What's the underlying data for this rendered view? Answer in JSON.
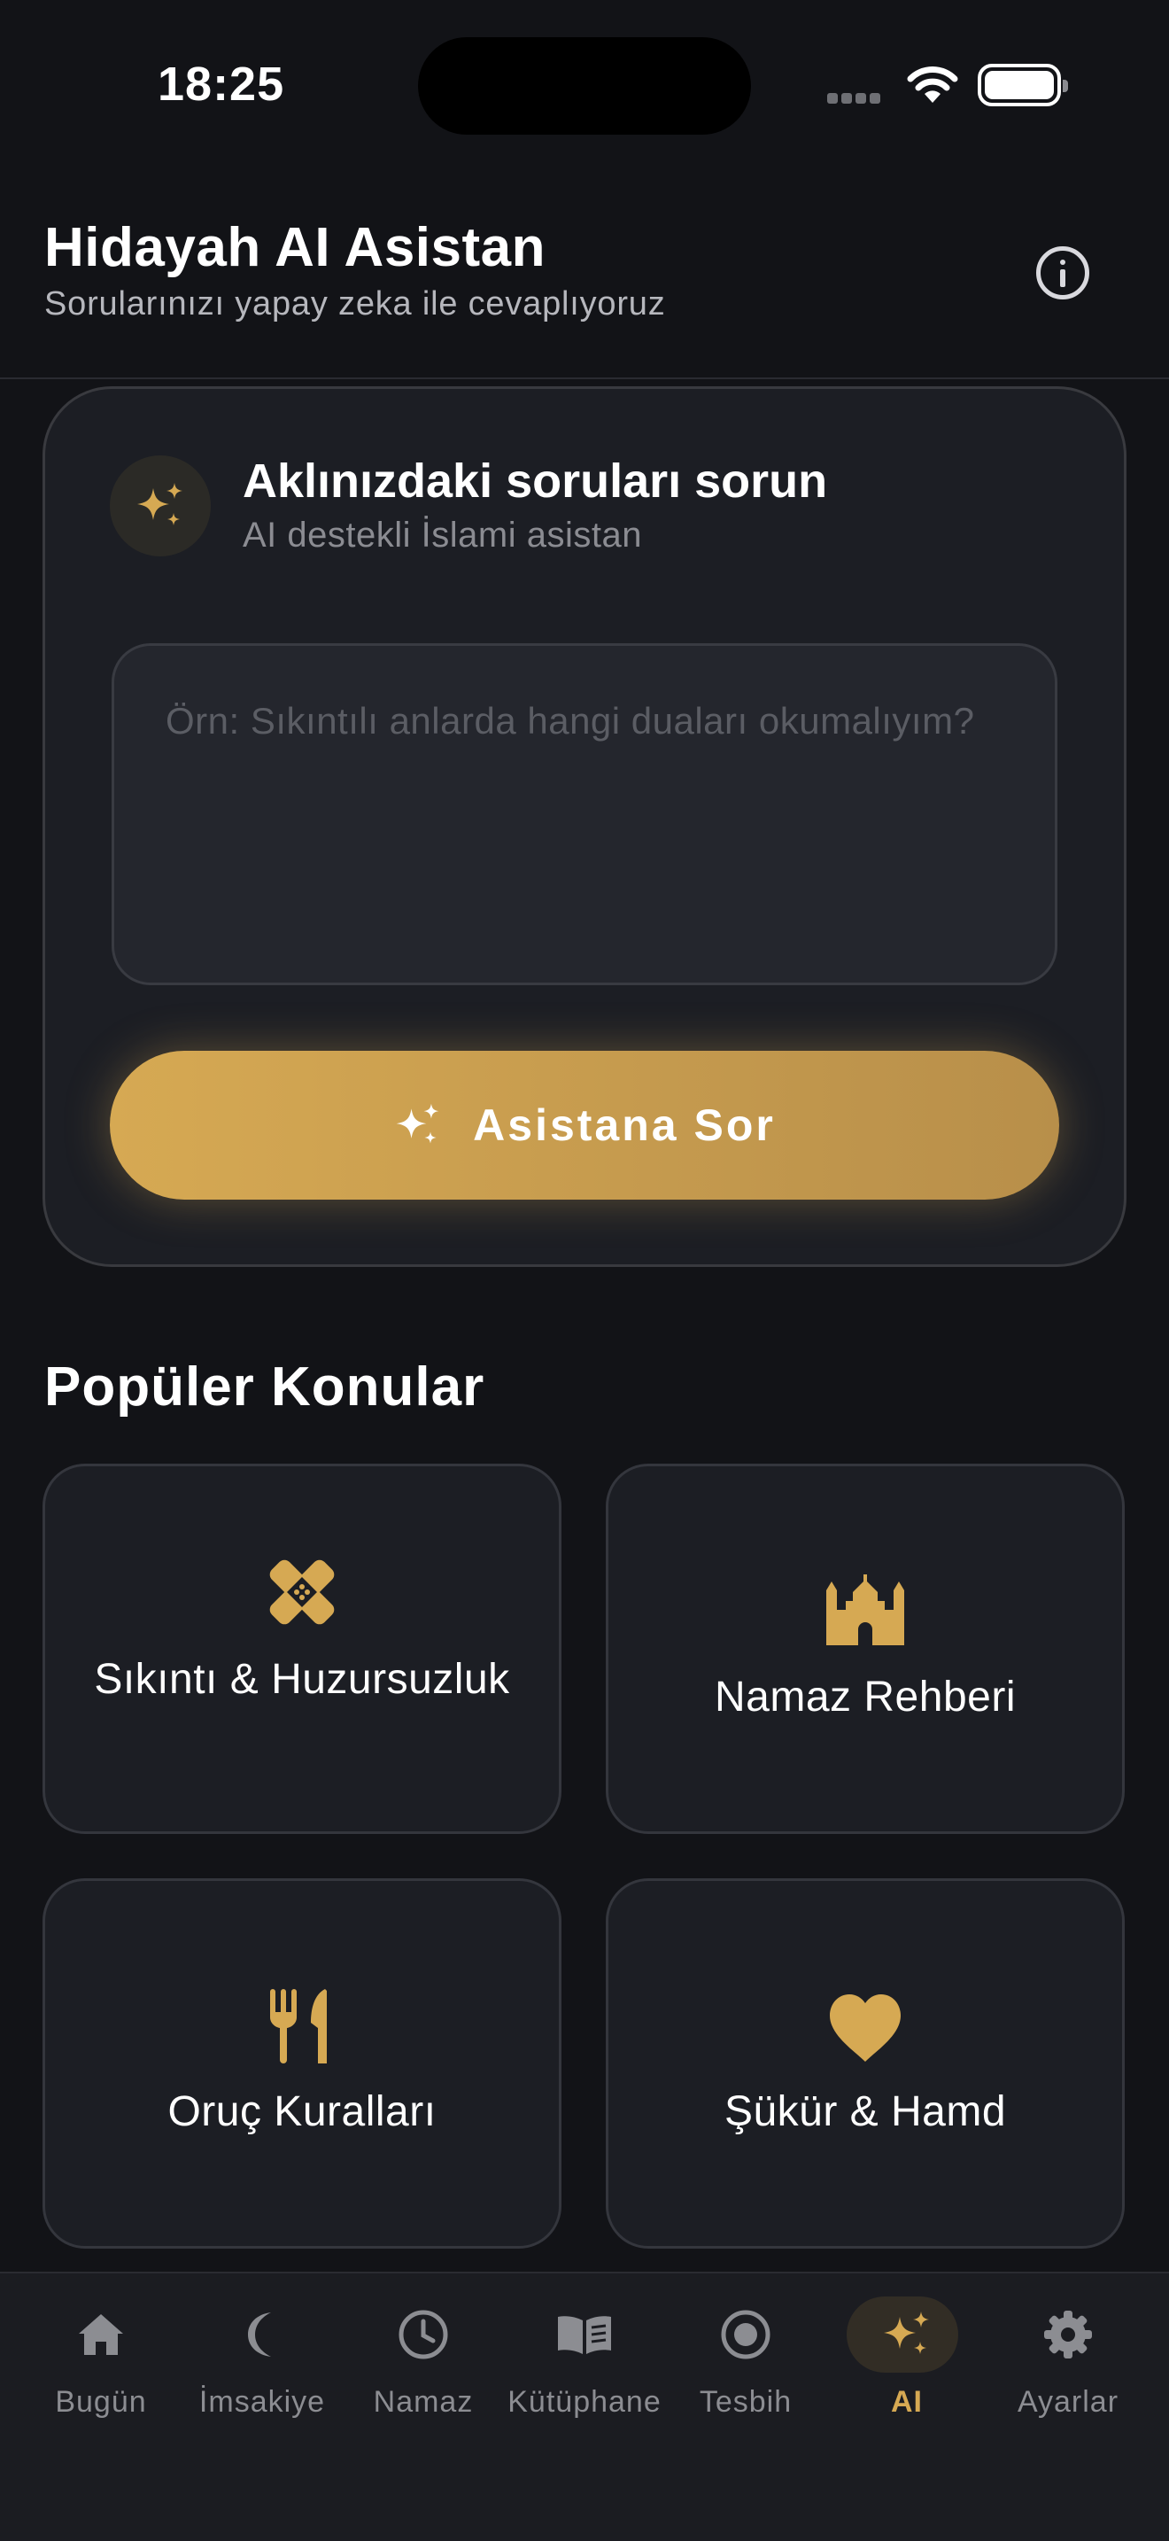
{
  "status_bar": {
    "time": "18:25"
  },
  "header": {
    "title": "Hidayah AI Asistan",
    "subtitle": "Sorularınızı yapay zeka ile cevaplıyoruz",
    "info_icon": "info-circle-icon"
  },
  "ask_card": {
    "title": "Aklınızdaki soruları sorun",
    "subtitle": "AI destekli İslami asistan",
    "input_value": "",
    "input_placeholder": "Örn: Sıkıntılı anlarda hangi duaları okumalıyım?",
    "button_label": "Asistana Sor",
    "icon": "sparkles-icon"
  },
  "popular": {
    "title": "Popüler Konular",
    "topics": [
      {
        "label": "Sıkıntı & Huzursuzluk",
        "icon": "bandage-icon"
      },
      {
        "label": "Namaz Rehberi",
        "icon": "mosque-icon"
      },
      {
        "label": "Oruç Kuralları",
        "icon": "utensils-icon"
      },
      {
        "label": "Şükür & Hamd",
        "icon": "heart-icon"
      }
    ]
  },
  "tab_bar": {
    "active": "AI",
    "tabs": [
      {
        "label": "Bugün",
        "icon": "home-icon"
      },
      {
        "label": "İmsakiye",
        "icon": "moon-icon"
      },
      {
        "label": "Namaz",
        "icon": "clock-icon"
      },
      {
        "label": "Kütüphane",
        "icon": "book-icon"
      },
      {
        "label": "Tesbih",
        "icon": "target-icon"
      },
      {
        "label": "AI",
        "icon": "sparkles-icon"
      },
      {
        "label": "Ayarlar",
        "icon": "gear-icon"
      }
    ]
  },
  "colors": {
    "background": "#121317",
    "card": "#1c1e24",
    "accent_gold": "#d6a953",
    "tab_inactive": "#8c8d92"
  }
}
